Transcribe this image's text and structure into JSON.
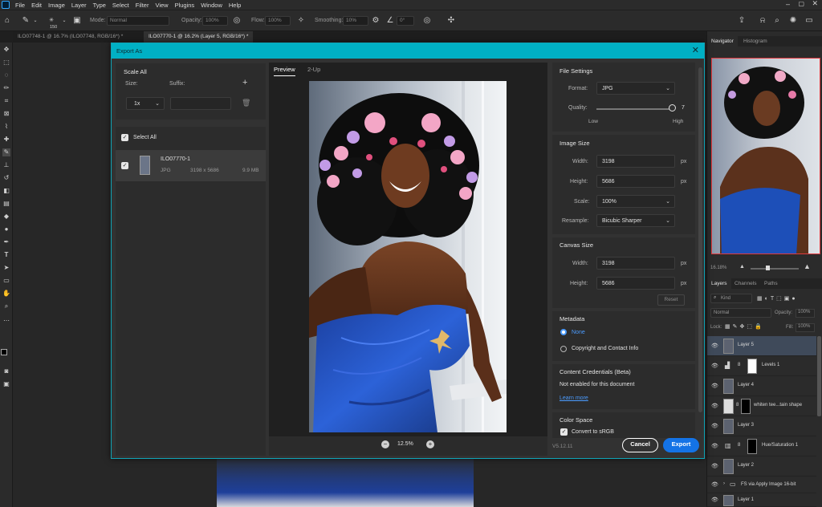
{
  "menubar": {
    "items": [
      "File",
      "Edit",
      "Image",
      "Layer",
      "Type",
      "Select",
      "Filter",
      "View",
      "Plugins",
      "Window",
      "Help"
    ]
  },
  "options": {
    "brush_size": "150",
    "mode_label": "Mode:",
    "mode_value": "Normal",
    "opacity_label": "Opacity:",
    "opacity_value": "100%",
    "flow_label": "Flow:",
    "flow_value": "100%",
    "smoothing_label": "Smoothing:",
    "smoothing_value": "10%",
    "angle_value": "0°"
  },
  "doc_tabs": [
    {
      "label": "ILO07748-1 @ 16.7% (ILO07748, RGB/16*) *"
    },
    {
      "label": "ILO07770-1 @ 16.2% (Layer 5, RGB/16*) *"
    }
  ],
  "panels": {
    "navigator_tab": "Navigator",
    "histogram_tab": "Histogram",
    "zoom_percent": "16.18%",
    "layers_tab": "Layers",
    "channels_tab": "Channels",
    "paths_tab": "Paths",
    "kind_filter": "Kind",
    "blend_mode": "Normal",
    "opacity_label": "Opacity:",
    "opacity_value": "100%",
    "lock_label": "Lock:",
    "fill_label": "Fill:",
    "fill_value": "100%",
    "layers": [
      {
        "name": "Layer 5"
      },
      {
        "name": "Levels 1"
      },
      {
        "name": "Layer 4"
      },
      {
        "name": "whiten tee...tain shape"
      },
      {
        "name": "Layer 3"
      },
      {
        "name": "Hue/Saturation 1"
      },
      {
        "name": "Layer 2"
      },
      {
        "name": "FS via Apply Image 16-bit"
      },
      {
        "name": "Layer 1"
      }
    ]
  },
  "dialog": {
    "title": "Export As",
    "scale_all": "Scale All",
    "size_label": "Size:",
    "suffix_label": "Suffix:",
    "size_value": "1x",
    "select_all": "Select All",
    "file": {
      "name": "ILO07770-1",
      "format": "JPG",
      "dimensions": "3198 x 5686",
      "filesize": "9.9 MB"
    },
    "preview_tab": "Preview",
    "twoup_tab": "2-Up",
    "zoom_value": "12.5%",
    "file_settings": "File Settings",
    "format_label": "Format:",
    "format_value": "JPG",
    "quality_label": "Quality:",
    "quality_value": "7",
    "quality_low": "Low",
    "quality_high": "High",
    "image_size": "Image Size",
    "width_label": "Width:",
    "height_label": "Height:",
    "width_value": "3198",
    "height_value": "5686",
    "px": "px",
    "scale_label": "Scale:",
    "scale_value": "100%",
    "resample_label": "Resample:",
    "resample_value": "Bicubic Sharper",
    "canvas_size": "Canvas Size",
    "canvas_width": "3198",
    "canvas_height": "5686",
    "reset": "Reset",
    "metadata": "Metadata",
    "meta_none": "None",
    "meta_copyright": "Copyright and Contact Info",
    "content_credentials": "Content Credentials (Beta)",
    "cc_status": "Not enabled for this document",
    "learn_more": "Learn more",
    "color_space": "Color Space",
    "convert_srgb": "Convert to sRGB",
    "version": "V5.12.11",
    "cancel": "Cancel",
    "export": "Export"
  }
}
